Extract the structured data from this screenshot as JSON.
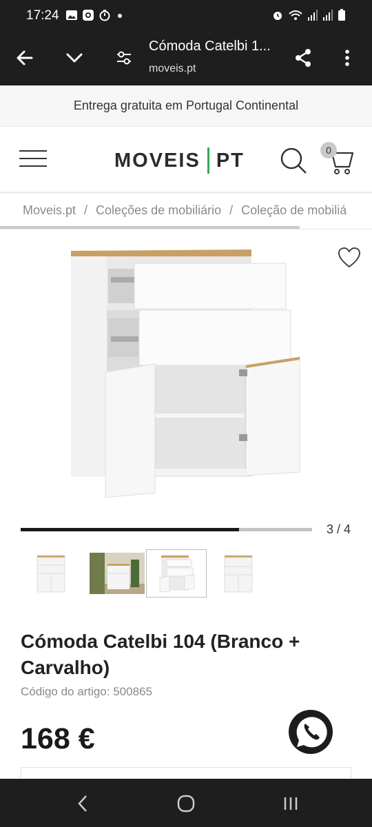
{
  "status_bar": {
    "time": "17:24",
    "left_icons": [
      "image-icon",
      "instagram-icon",
      "timer-icon",
      "dot-icon"
    ],
    "right_icons": [
      "alarm-icon",
      "wifi-icon",
      "signal-icon",
      "signal-icon",
      "battery-icon"
    ]
  },
  "browser": {
    "page_title": "Cómoda Catelbi 1...",
    "url": "moveis.pt"
  },
  "promo": {
    "text": "Entrega gratuita em Portugal Continental"
  },
  "header": {
    "logo_left": "MOVEIS",
    "logo_right": "PT",
    "cart_count": "0",
    "accent_color": "#34a853"
  },
  "breadcrumb": [
    "Moveis.pt",
    "Coleções de mobiliário",
    "Coleção de mobiliá"
  ],
  "gallery": {
    "counter": "3 / 4",
    "progress_fraction": 0.75,
    "thumbnails": [
      "dresser-front",
      "dresser-room",
      "dresser-open",
      "dresser-closed"
    ],
    "active_thumbnail": 2
  },
  "product": {
    "title": "Cómoda Catelbi 104 (Branco + Carvalho)",
    "sku": "Código do artigo: 500865",
    "price": "168 €"
  }
}
